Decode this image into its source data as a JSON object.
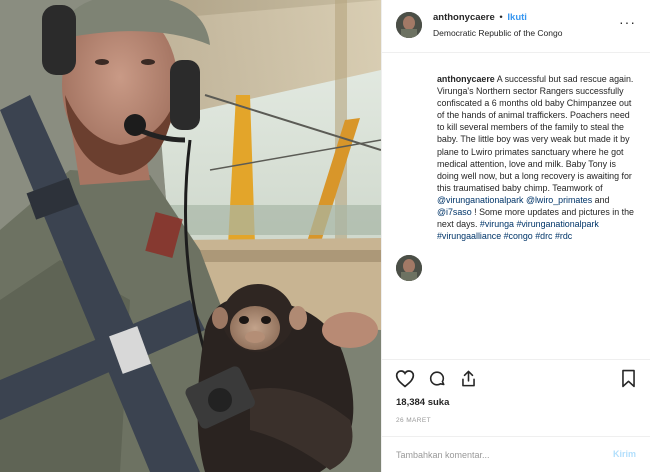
{
  "colors": {
    "accent": "#3897f0",
    "link": "#003569",
    "muted": "#999999",
    "border": "#efefef",
    "post_disabled": "#b2dffc"
  },
  "photo": {
    "subject": "pilot with baby chimpanzee in aircraft cockpit"
  },
  "header": {
    "username": "anthonycaere",
    "separator": "•",
    "follow_label": "Ikuti",
    "location": "Democratic Republic of the Congo",
    "more_icon": "ellipsis-icon",
    "more_glyph": "···"
  },
  "caption": {
    "username": "anthonycaere",
    "text": "A successful but sad rescue again. Virunga's Northern sector Rangers successfully confiscated a 6 months old baby Chimpanzee out of the hands of animal traffickers. Poachers need to kill several members of the family to steal the baby. The little boy was very weak but made it by plane to Lwiro primates sanctuary where he got medical attention, love and milk. Baby Tony is doing well now, but a long recovery is awaiting for this traumatised baby chimp. Teamwork of ",
    "mention1": "@virunganationalpark",
    "mention2": "@lwiro_primates",
    "and_text": " and ",
    "mention3": "@i7saso",
    "tail_text": " ! Some more updates and pictures in the next days. ",
    "tag1": "#virunga",
    "tag2": "#virunganationalpark",
    "tag3": "#virungaalliance",
    "tag4": "#congo",
    "tag5": "#drc",
    "tag6": "#rdc"
  },
  "actions": {
    "icons": [
      "heart-icon",
      "comment-icon",
      "share-icon",
      "bookmark-icon"
    ],
    "likes": "18,384 suka",
    "date": "26 MARET"
  },
  "comment": {
    "placeholder": "Tambahkan komentar...",
    "post_label": "Kirim"
  }
}
